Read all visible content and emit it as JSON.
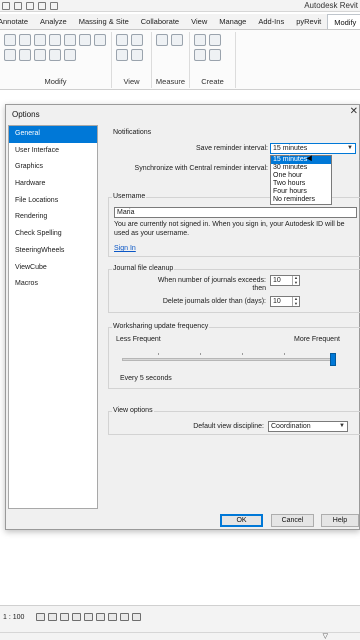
{
  "app": {
    "title": "Autodesk Revit"
  },
  "ribbon": {
    "tabs": [
      "Annotate",
      "Analyze",
      "Massing & Site",
      "Collaborate",
      "View",
      "Manage",
      "Add-Ins",
      "pyRevit",
      "Modify"
    ],
    "active_tab": "Modify",
    "groups": [
      "Modify",
      "View",
      "Measure",
      "Create"
    ]
  },
  "dialog": {
    "title": "Options",
    "close_glyph": "✕",
    "nav": [
      "General",
      "User Interface",
      "Graphics",
      "Hardware",
      "File Locations",
      "Rendering",
      "Check Spelling",
      "SteeringWheels",
      "ViewCube",
      "Macros"
    ],
    "selected_nav": "General",
    "notifications": {
      "header": "Notifications",
      "save_reminder_label": "Save reminder interval:",
      "save_reminder_value": "15 minutes",
      "sync_reminder_label": "Synchronize with Central reminder interval:",
      "dropdown_options": [
        "15 minutes",
        "30 minutes",
        "One hour",
        "Two hours",
        "Four hours",
        "No reminders"
      ],
      "highlighted_option": "15 minutes"
    },
    "username": {
      "header": "Username",
      "value": "Maria",
      "note": "You are currently not signed in. When you sign in, your Autodesk ID will be used as your username.",
      "sign_in_link": "Sign In"
    },
    "journal": {
      "header": "Journal file cleanup",
      "exceeds_label": "When number of journals exceeds:",
      "then_label": "then",
      "exceeds_value": "10",
      "delete_label": "Delete journals older than (days):",
      "delete_value": "10"
    },
    "worksharing": {
      "header": "Worksharing update frequency",
      "less_label": "Less Frequent",
      "more_label": "More Frequent",
      "level": 1.0,
      "status": "Every 5 seconds"
    },
    "view_options": {
      "header": "View options",
      "discipline_label": "Default view discipline:",
      "discipline_value": "Coordination"
    },
    "buttons": {
      "ok": "OK",
      "cancel": "Cancel",
      "help": "Help"
    }
  },
  "statusbar": {
    "scale": "1 : 100"
  },
  "colors": {
    "accent": "#0078d7",
    "link": "#0b57c6",
    "dialog_bg": "#f0f0f0"
  }
}
